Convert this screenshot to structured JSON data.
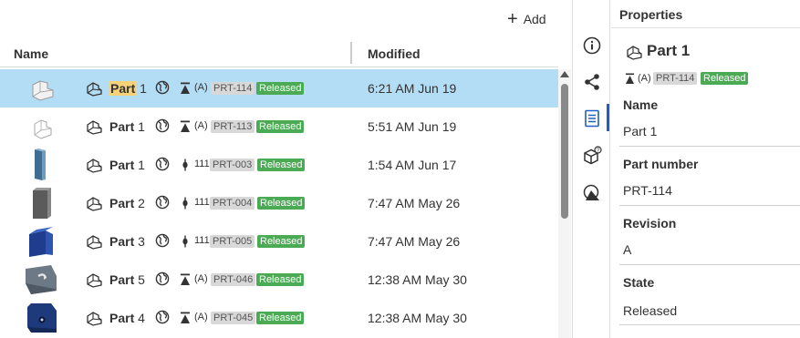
{
  "toolbar": {
    "add_label": "Add"
  },
  "columns": {
    "name": "Name",
    "modified": "Modified"
  },
  "rows": [
    {
      "name_bold": "Part",
      "name_num": "1",
      "revision": "(A)",
      "part_number": "PRT-114",
      "state": "Released",
      "modified": "6:21 AM Jun 19",
      "selected": true,
      "highlight": true,
      "rev_kind": "released",
      "thumb": "bracket-light"
    },
    {
      "name_bold": "Part",
      "name_num": "1",
      "revision": "(A)",
      "part_number": "PRT-113",
      "state": "Released",
      "modified": "5:51 AM Jun 19",
      "selected": false,
      "highlight": false,
      "rev_kind": "released",
      "thumb": "bracket-outline"
    },
    {
      "name_bold": "Part",
      "name_num": "1",
      "revision": "111",
      "part_number": "PRT-003",
      "state": "Released",
      "modified": "1:54 AM Jun 17",
      "selected": false,
      "highlight": false,
      "rev_kind": "version",
      "thumb": "bar-blue"
    },
    {
      "name_bold": "Part",
      "name_num": "2",
      "revision": "111",
      "part_number": "PRT-004",
      "state": "Released",
      "modified": "7:47 AM May 26",
      "selected": false,
      "highlight": false,
      "rev_kind": "version",
      "thumb": "block-gray"
    },
    {
      "name_bold": "Part",
      "name_num": "3",
      "revision": "111",
      "part_number": "PRT-005",
      "state": "Released",
      "modified": "7:47 AM May 26",
      "selected": false,
      "highlight": false,
      "rev_kind": "version",
      "thumb": "cube-blue"
    },
    {
      "name_bold": "Part",
      "name_num": "5",
      "revision": "(A)",
      "part_number": "PRT-046",
      "state": "Released",
      "modified": "12:38 AM May 30",
      "selected": false,
      "highlight": false,
      "rev_kind": "released",
      "thumb": "plate-gray"
    },
    {
      "name_bold": "Part",
      "name_num": "4",
      "revision": "(A)",
      "part_number": "PRT-045",
      "state": "Released",
      "modified": "12:38 AM May 30",
      "selected": false,
      "highlight": false,
      "rev_kind": "released",
      "thumb": "plate-navy"
    }
  ],
  "rail": [
    "info-icon",
    "share-icon",
    "properties-icon",
    "cube-help-icon",
    "appearance-icon"
  ],
  "properties": {
    "title": "Properties",
    "part_name": "Part 1",
    "revision": "(A)",
    "part_number": "PRT-114",
    "state": "Released",
    "fields": [
      {
        "label": "Name",
        "value": "Part 1"
      },
      {
        "label": "Part number",
        "value": "PRT-114"
      },
      {
        "label": "Revision",
        "value": "A"
      },
      {
        "label": "State",
        "value": "Released"
      }
    ]
  },
  "colors": {
    "selected_row": "#b3dcf5",
    "released_badge": "#4bab55",
    "part_number_badge": "#d8d8d8",
    "highlight": "#f5d27a",
    "accent": "#1f5fbf"
  }
}
